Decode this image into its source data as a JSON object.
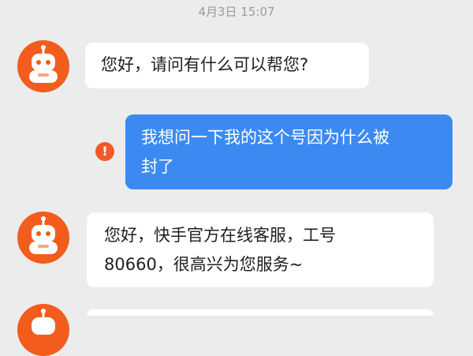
{
  "chat": {
    "timestamp": "4月3日 15:07",
    "messages": [
      {
        "sender": "agent",
        "avatar_icon": "robot-icon",
        "text": "您好，请问有什么可以帮您?"
      },
      {
        "sender": "user",
        "status_icon": "alert-icon",
        "status_glyph": "!",
        "text_lines": [
          "我想问一下我的这个号因为什么被",
          "封了"
        ]
      },
      {
        "sender": "agent",
        "avatar_icon": "robot-icon",
        "text_lines": [
          "您好，快手官方在线客服，工号",
          "80660，很高兴为您服务~"
        ]
      },
      {
        "sender": "agent",
        "avatar_icon": "robot-icon"
      }
    ]
  },
  "colors": {
    "background": "#ececec",
    "agent_bubble": "#ffffff",
    "user_bubble": "#3c8af1",
    "avatar": "#f25c1c",
    "alert": "#f05a2a"
  }
}
